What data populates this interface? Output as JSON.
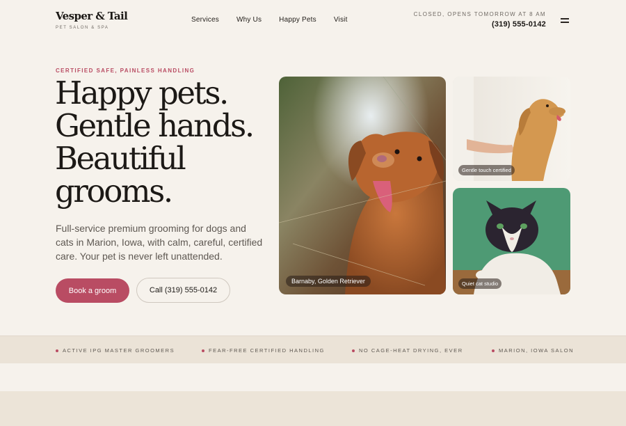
{
  "brand": {
    "name": "Vesper & Tail",
    "tagline": "PET SALON & SPA"
  },
  "nav": {
    "items": [
      {
        "label": "Services"
      },
      {
        "label": "Why Us"
      },
      {
        "label": "Happy Pets"
      },
      {
        "label": "Visit"
      }
    ]
  },
  "status": {
    "text": "CLOSED, OPENS TOMORROW AT 8 AM",
    "phone": "(319) 555-0142"
  },
  "menu": {
    "icon": "hamburger-menu-icon"
  },
  "hero": {
    "eyebrow": "CERTIFIED SAFE, PAINLESS HANDLING",
    "headline_lines": [
      "Happy pets.",
      "Gentle hands.",
      "Beautiful",
      "grooms."
    ],
    "lede": "Full-service premium grooming for dogs and cats in Marion, Iowa, with calm, careful, certified care. Your pet is never left unattended.",
    "primary_cta": "Book a groom",
    "secondary_cta": "Call (319) 555-0142"
  },
  "gallery": {
    "main_caption": "Barnaby, Golden Retriever",
    "top_right_caption": "Gentle touch certified",
    "bottom_right_caption": "Quiet cat studio"
  },
  "trust_band": {
    "items": [
      "ACTIVE IPG MASTER GROOMERS",
      "FEAR-FREE CERTIFIED HANDLING",
      "NO CAGE-HEAT DRYING, EVER",
      "MARION, IOWA SALON"
    ]
  },
  "colors": {
    "accent": "#b94c63",
    "background": "#f6f2ec",
    "band": "#ebe3d7",
    "ink": "#1c1916"
  }
}
